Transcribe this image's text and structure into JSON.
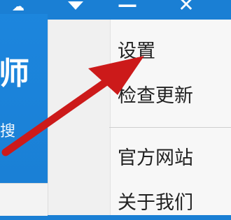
{
  "app": {
    "big_char": "师",
    "small_char": "搜"
  },
  "titlebar": {
    "share_icon": "cloud-share-icon",
    "menu_icon": "triangle-down-icon",
    "minimize_label": "—",
    "close_label": "✕"
  },
  "menu": {
    "items": [
      {
        "label": "设置"
      },
      {
        "label": "检查更新"
      },
      {
        "label": "官方网站"
      },
      {
        "label": "关于我们"
      }
    ]
  },
  "annotation": {
    "arrow_color": "#cc1a1a"
  }
}
